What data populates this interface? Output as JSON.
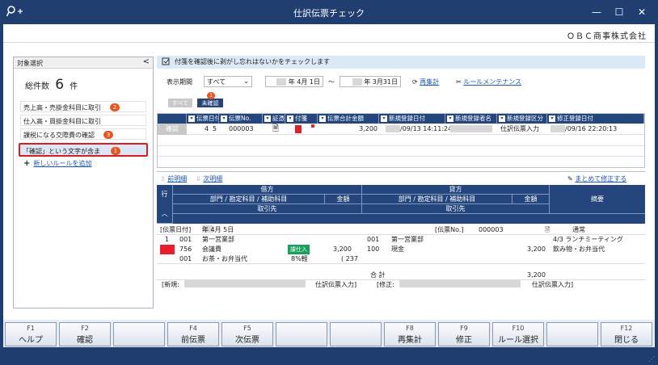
{
  "window": {
    "title": "仕訳伝票チェック",
    "company": "ＯＢＣ商事株式会社",
    "controls": {
      "minimize": "—",
      "maximize": "☐",
      "close": "✕"
    }
  },
  "left_panel": {
    "header": "対象選択",
    "collapse_glyph": "<",
    "total_label": "総件数",
    "total_count": "6",
    "total_unit": "件",
    "rules": [
      {
        "label": "売上高・売掛金科目に取引",
        "badge": "2"
      },
      {
        "label": "仕入高・買掛金科目に取引",
        "badge": ""
      },
      {
        "label": "課税になる交際費の確認",
        "badge": "3"
      },
      {
        "label": "「確認」という文字が含ま",
        "badge": "1",
        "selected": true
      }
    ],
    "add_rule": "新しいルールを追加"
  },
  "info_bar": {
    "text": "付箋を確認後に剥がし忘れはないかをチェックします"
  },
  "filter": {
    "period_label": "表示期間",
    "period_value": "すべて",
    "date_from": "年  4月  1日",
    "range_sep": "〜",
    "date_to": "年  3月31日",
    "recalc_link": "再集計",
    "maintenance_link": "ルールメンテナンス"
  },
  "toggles": {
    "all": "すべて",
    "unconfirmed": "未確認",
    "unconfirmed_badge": "1"
  },
  "list_grid": {
    "columns": [
      "伝票日付",
      "伝票No.",
      "証憑",
      "付箋",
      "伝票合計金額",
      "新規登録日付",
      "新規登録者名",
      "新規登録区分",
      "修正登録日付"
    ],
    "row": {
      "status": "確認",
      "month": "4",
      "day": "5",
      "voucher_no": "000003",
      "total": "3,200",
      "created": "/09/13 14:11:24",
      "created_kind": "仕訳伝票入力",
      "modified": "/09/16 22:20:13"
    }
  },
  "detail": {
    "prev_link": "前明細",
    "next_link": "次明細",
    "edit_all": "まとめて修正する",
    "head": {
      "row_label": "行",
      "debit": "借方",
      "credit": "貸方",
      "dept_account": "部門 / 勘定科目 / 補助科目",
      "amount": "金額",
      "partner": "取引先",
      "memo": "摘要"
    },
    "voucher_date_label": "[伝票日付]",
    "voucher_date_value": "年  4月  5日",
    "voucher_no_label": "[伝票No.]",
    "voucher_no_value": "000003",
    "entry_kind": "通常",
    "lines": {
      "row_no": "1",
      "debit_dept_code": "001",
      "debit_dept": "第一営業部",
      "debit_acct_code": "756",
      "debit_acct": "会議費",
      "debit_tag": "課仕入",
      "debit_amount": "3,200",
      "debit_sub_code": "001",
      "debit_sub": "お茶・お弁当代",
      "tax_rate": "8%軽",
      "tax_amount": "( 237",
      "credit_dept_code": "001",
      "credit_dept": "第一営業部",
      "credit_acct_code": "100",
      "credit_acct": "現金",
      "credit_amount": "3,200",
      "memo1": "4/3 ランチミーティング",
      "memo2": "飲み物・お弁当代"
    },
    "total_label": "合 計",
    "total_value": "3,200",
    "new_label": "[新規:",
    "new_kind": "仕訳伝票入力]",
    "mod_label": "[修正:",
    "mod_kind": "仕訳伝票入力]"
  },
  "fkeys": [
    {
      "fn": "F1",
      "label": "ヘルプ"
    },
    {
      "fn": "F2",
      "label": "確認"
    },
    {
      "fn": "",
      "label": ""
    },
    {
      "fn": "F4",
      "label": "前伝票"
    },
    {
      "fn": "F5",
      "label": "次伝票"
    },
    {
      "fn": "",
      "label": ""
    },
    {
      "fn": "",
      "label": ""
    },
    {
      "fn": "F8",
      "label": "再集計"
    },
    {
      "fn": "F9",
      "label": "修正"
    },
    {
      "fn": "F10",
      "label": "ルール選択"
    },
    {
      "fn": "",
      "label": ""
    },
    {
      "fn": "F12",
      "label": "閉じる"
    }
  ]
}
